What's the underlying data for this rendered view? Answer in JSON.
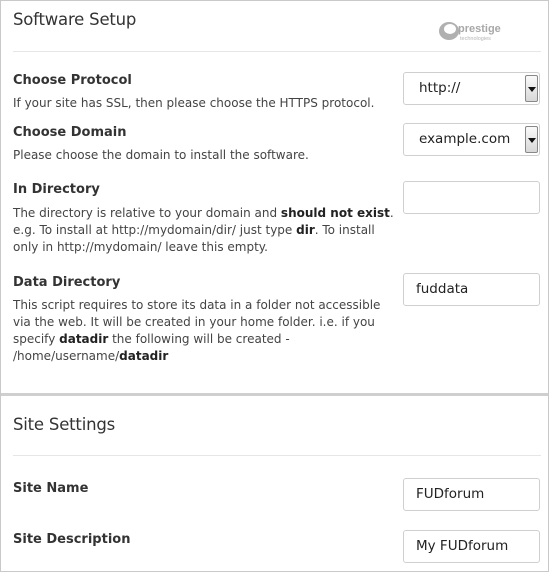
{
  "software_setup": {
    "title": "Software Setup",
    "logo_text": "prestige",
    "logo_subtext": "technologies",
    "protocol": {
      "label": "Choose Protocol",
      "description": "If your site has SSL, then please choose the HTTPS protocol.",
      "value": "http://"
    },
    "domain": {
      "label": "Choose Domain",
      "description": "Please choose the domain to install the software.",
      "value": "example.com"
    },
    "directory": {
      "label": "In Directory",
      "desc_part1": "The directory is relative to your domain and ",
      "desc_bold1": "should not exist",
      "desc_part2": ". e.g. To install at http://mydomain/dir/ just type ",
      "desc_bold2": "dir",
      "desc_part3": ". To install only in http://mydomain/ leave this empty.",
      "value": ""
    },
    "data_directory": {
      "label": "Data Directory",
      "desc_part1": "This script requires to store its data in a folder not accessible via the web. It will be created in your home folder. i.e. if you specify ",
      "desc_bold1": "datadir",
      "desc_part2": " the following will be created - /home/username/",
      "desc_bold2": "datadir",
      "value": "fuddata"
    }
  },
  "site_settings": {
    "title": "Site Settings",
    "site_name": {
      "label": "Site Name",
      "value": "FUDforum"
    },
    "site_description": {
      "label": "Site Description",
      "value": "My FUDforum"
    }
  }
}
